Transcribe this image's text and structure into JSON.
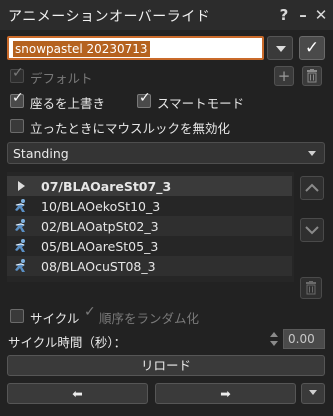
{
  "window": {
    "title": "アニメーションオーバーライド",
    "help_glyph": "?",
    "minimize_glyph": "–",
    "close_glyph": "✕"
  },
  "set": {
    "name_value": "snowpastel 20230713",
    "confirm_glyph": "✓"
  },
  "options": {
    "default_label": "デフォルト",
    "override_sit_label": "座るを上書き",
    "smart_mode_label": "スマートモード",
    "disable_mouselook_label": "立ったときにマウスルックを無効化",
    "add_glyph": "+",
    "check_glyph": "✓"
  },
  "state_combo": {
    "selected": "Standing"
  },
  "animations": {
    "items": [
      "07/BLAOareSt07_3",
      "10/BLAOekoSt10_3",
      "02/BLAOatpSt02_3",
      "05/BLAOareSt05_3",
      "08/BLAOcuST08_3"
    ]
  },
  "cycle": {
    "cycle_label": "サイクル",
    "random_order_label": "順序をランダム化",
    "cycle_time_label": "サイクル時間（秒）：",
    "cycle_time_value": "0.00"
  },
  "buttons": {
    "reload_label": "リロード",
    "prev_glyph": "⬅",
    "next_glyph": "➡"
  },
  "colors": {
    "background": "#222222",
    "accent_orange": "#c96a2a",
    "selection": "#b5621f"
  }
}
